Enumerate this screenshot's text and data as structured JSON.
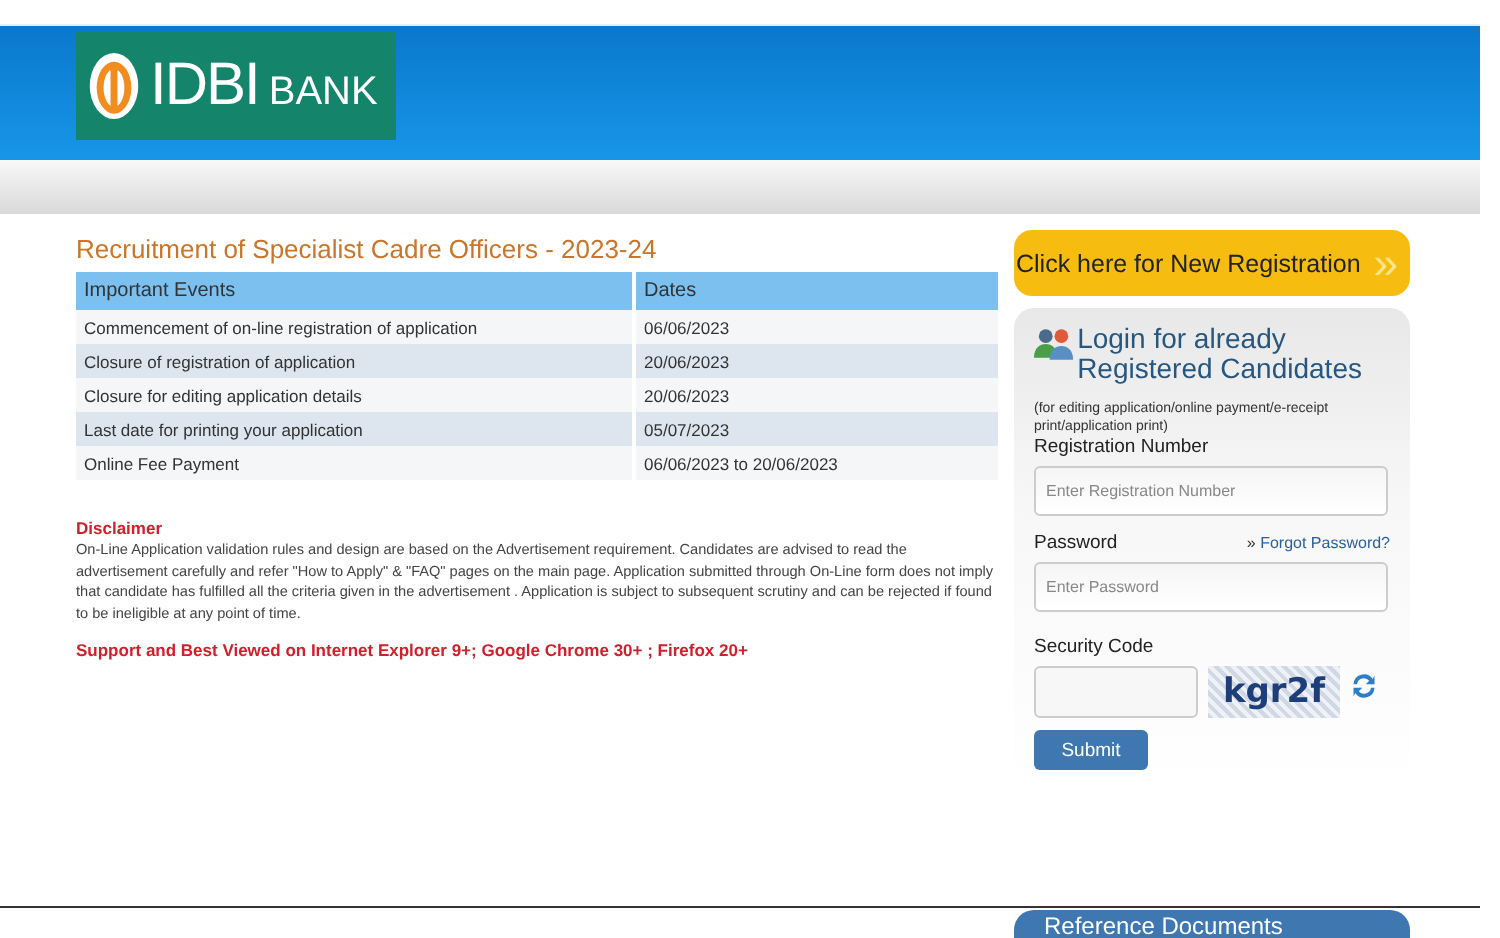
{
  "header": {
    "logo_text": "IDBI",
    "logo_subtext": "BANK"
  },
  "recruitment": {
    "title": "Recruitment of Specialist Cadre Officers - 2023-24",
    "columns": [
      "Important Events",
      "Dates"
    ],
    "rows": [
      {
        "event": "Commencement of on-line registration of application",
        "date": "06/06/2023"
      },
      {
        "event": "Closure of registration of application",
        "date": "20/06/2023"
      },
      {
        "event": "Closure for editing application details",
        "date": "20/06/2023"
      },
      {
        "event": "Last date for printing your application",
        "date": "05/07/2023"
      },
      {
        "event": "Online Fee Payment",
        "date": "06/06/2023 to 20/06/2023"
      }
    ]
  },
  "disclaimer": {
    "heading": "Disclaimer",
    "text": "On-Line Application validation rules and design are based on the Advertisement requirement. Candidates are advised to read the advertisement carefully and refer \"How to Apply\" & \"FAQ\" pages on the main page. Application submitted through On-Line form does not imply that candidate has fulfilled all the criteria given in the advertisement . Application is subject to subsequent scrutiny and can be rejected if found to be ineligible at any point of time.",
    "support": "Support and Best Viewed on Internet Explorer 9+; Google Chrome 30+ ; Firefox 20+"
  },
  "new_registration": {
    "label": "Click here for New Registration",
    "arrow": "»"
  },
  "login": {
    "title": "Login for already Registered Candidates",
    "note": "(for editing application/online payment/e-receipt print/application print)",
    "registration_label": "Registration Number",
    "registration_placeholder": "Enter Registration Number",
    "password_label": "Password",
    "forgot_link": "Forgot Password?",
    "forgot_arrow": "»",
    "password_placeholder": "Enter Password",
    "security_label": "Security Code",
    "captcha": "kgr2f",
    "submit": "Submit"
  },
  "reference": {
    "title": "Reference Documents"
  }
}
